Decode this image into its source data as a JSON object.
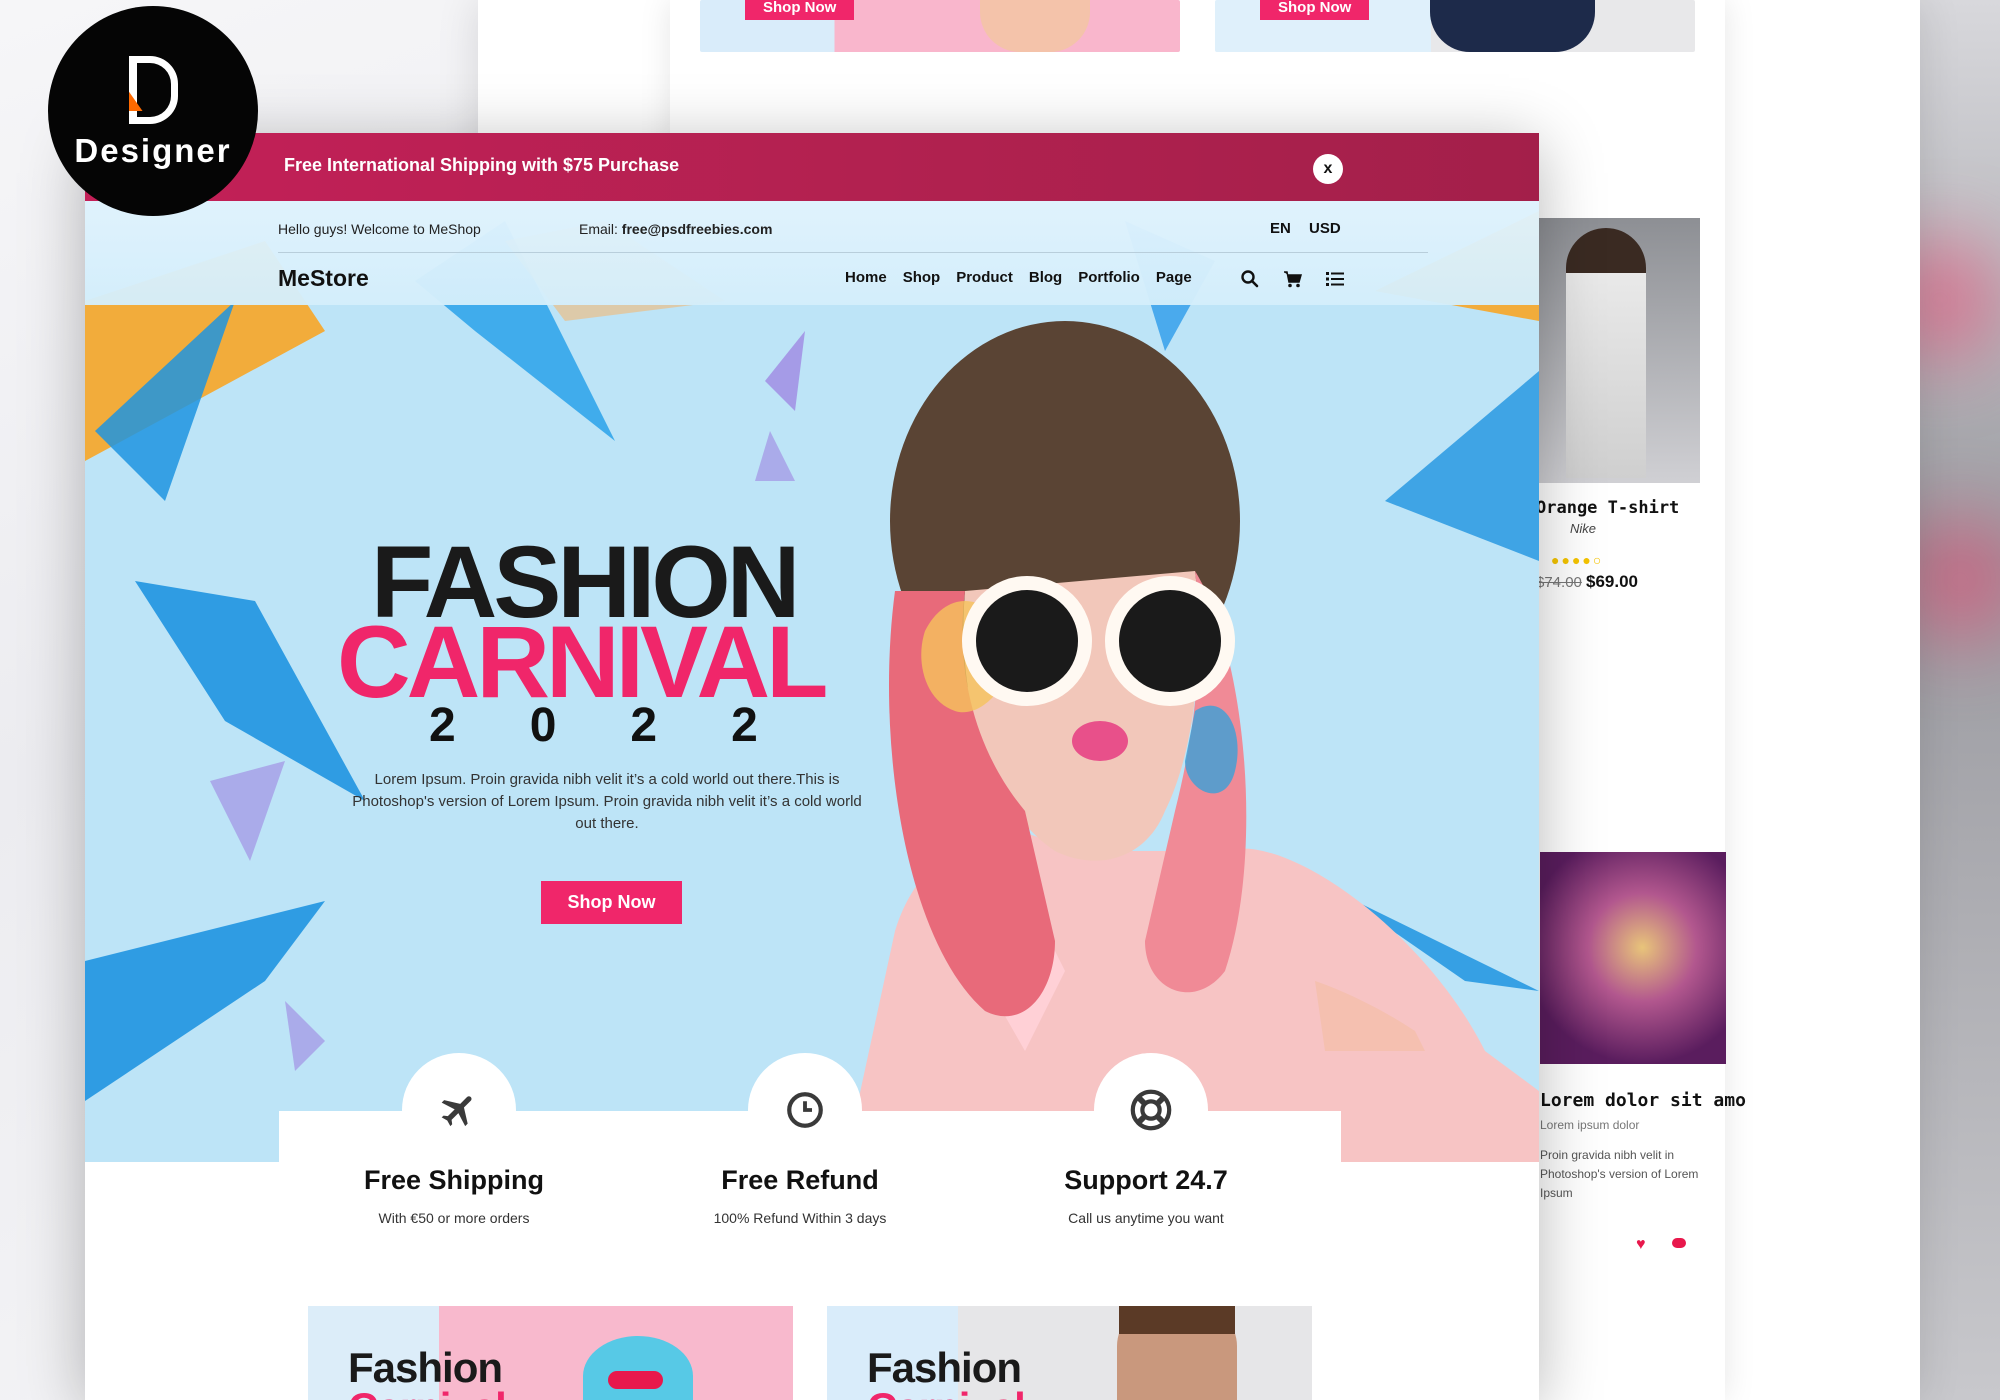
{
  "colors": {
    "accent": "#f0266a",
    "promo_bar": "#b0214f",
    "hero_bg": "#bde4f7",
    "text_dark": "#111111",
    "star": "#f5c400"
  },
  "logo": {
    "text": "Designer",
    "icon": "d-logo-icon"
  },
  "background_pages": {
    "mini_buttons": [
      "Shop Now",
      "Shop Now"
    ],
    "product": {
      "title": "Orange T-shirt",
      "subtitle": "Nike",
      "rating": 4,
      "rating_max": 5,
      "old_price": "$74.00",
      "price": "$69.00"
    },
    "blog": {
      "title": "Lorem dolor sit amo",
      "meta": "Lorem ipsum dolor",
      "text": "Proin gravida nibh velit in Photoshop's version of Lorem Ipsum",
      "icons": [
        "heart-icon",
        "comment-icon"
      ]
    }
  },
  "promo_bar": {
    "text": "Free International Shipping with $75 Purchase",
    "close": "x"
  },
  "topbar": {
    "welcome": "Hello guys! Welcome to MeShop",
    "email_label": "Email: ",
    "email": "free@psdfreebies.com",
    "language": "EN",
    "currency": "USD"
  },
  "header": {
    "brand": "MeStore",
    "nav": [
      "Home",
      "Shop",
      "Product",
      "Blog",
      "Portfolio",
      "Page"
    ],
    "icons": [
      "search-icon",
      "cart-icon",
      "menu-list-icon"
    ]
  },
  "hero": {
    "title_line1": "FASHION",
    "title_line2": "CARNIVAL",
    "year": "2022",
    "description": "Lorem Ipsum. Proin gravida nibh velit it’s a cold world out there.This is Photoshop's version of Lorem Ipsum. Proin gravida nibh velit it’s a cold world out there.",
    "button": "Shop Now"
  },
  "features": [
    {
      "icon": "airplane-icon",
      "title": "Free Shipping",
      "subtitle": "With €50 or more orders"
    },
    {
      "icon": "clock-icon",
      "title": "Free Refund",
      "subtitle": "100% Refund Within 3 days"
    },
    {
      "icon": "lifebuoy-icon",
      "title": "Support 24.7",
      "subtitle": "Call us anytime you want"
    }
  ],
  "promo_cards": [
    {
      "title_line1": "Fashion",
      "title_line2": "Carnival"
    },
    {
      "title_line1": "Fashion",
      "title_line2": "Carnival"
    }
  ]
}
